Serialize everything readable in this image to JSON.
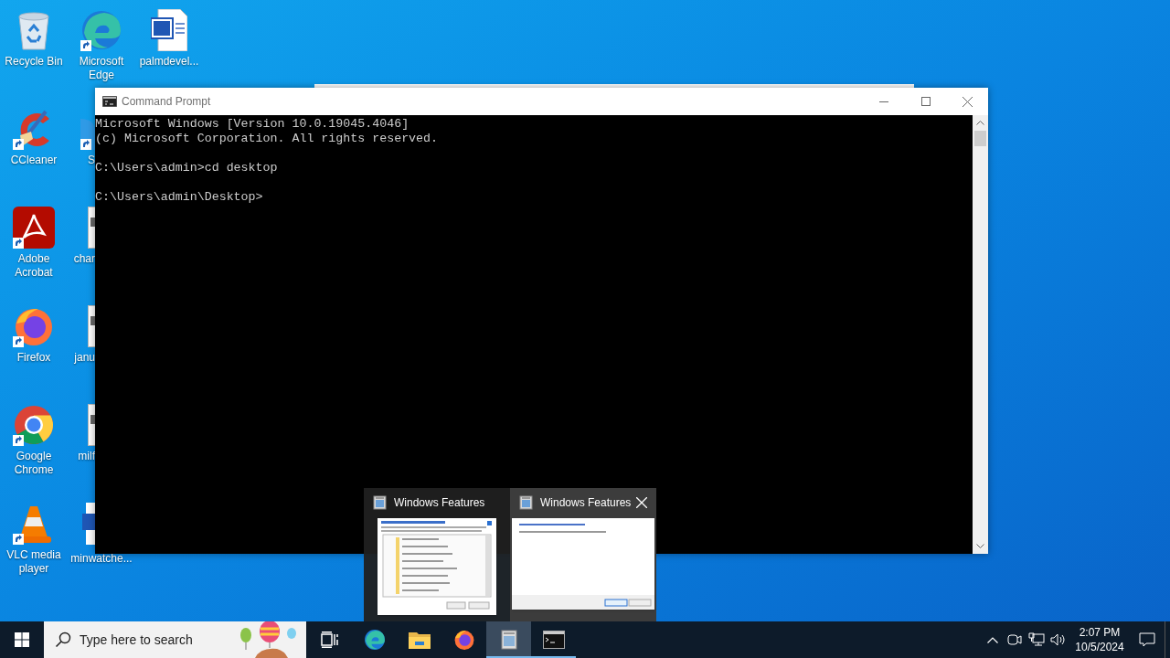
{
  "desktop": {
    "columns": [
      [
        {
          "label": "Recycle Bin",
          "shortcut": false
        },
        {
          "label": "CCleaner",
          "shortcut": true
        },
        {
          "label": "Adobe Acrobat",
          "shortcut": true
        },
        {
          "label": "Firefox",
          "shortcut": true
        },
        {
          "label": "Google Chrome",
          "shortcut": true
        },
        {
          "label": "VLC media player",
          "shortcut": true
        }
      ],
      [
        {
          "label": "Microsoft Edge",
          "shortcut": true
        },
        {
          "label": "S",
          "shortcut": true
        },
        {
          "label": "char",
          "shortcut": false
        },
        {
          "label": "janu",
          "shortcut": false
        },
        {
          "label": "milf",
          "shortcut": false
        },
        {
          "label": "minwatche...",
          "shortcut": false
        }
      ],
      [
        {
          "label": "palmdevel...",
          "shortcut": false
        }
      ]
    ]
  },
  "window": {
    "title": "Command Prompt",
    "console": [
      [
        "Microsoft Windows [Version 10.0.19045.4046]",
        "(c) Microsoft Corporation. All rights reserved."
      ],
      [
        "C:\\Users\\admin>cd desktop"
      ],
      [
        "C:\\Users\\admin\\Desktop>"
      ]
    ]
  },
  "previews": [
    {
      "title": "Windows Features",
      "selected": false
    },
    {
      "title": "Windows Features",
      "selected": true
    }
  ],
  "taskbar": {
    "search": {
      "placeholder": "Type here to search"
    },
    "apps": [
      {
        "active": false,
        "running": false
      },
      {
        "active": false,
        "running": false
      },
      {
        "active": false,
        "running": false
      },
      {
        "active": false,
        "running": false
      },
      {
        "active": true,
        "running": true
      },
      {
        "active": false,
        "running": true
      }
    ],
    "time": "2:07 PM",
    "date": "10/5/2024"
  }
}
